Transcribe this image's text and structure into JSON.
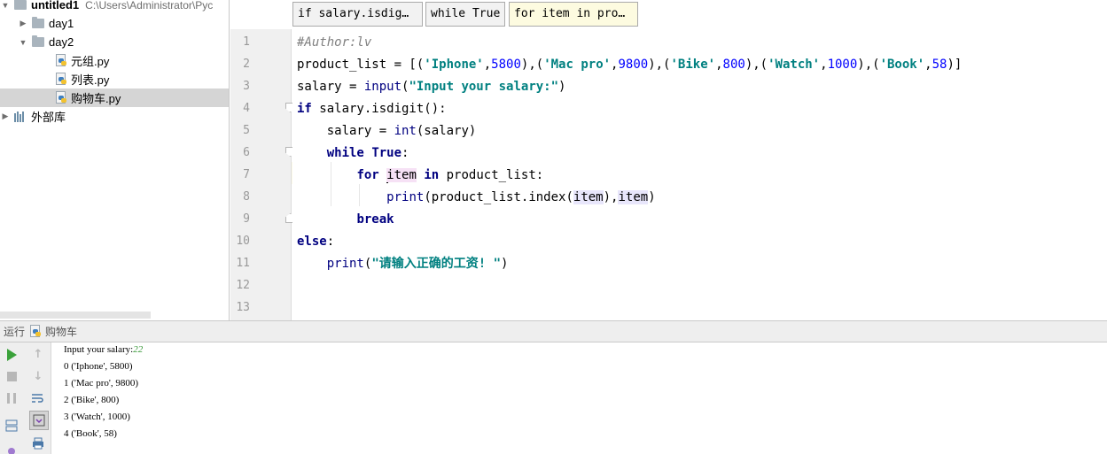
{
  "project": {
    "root_name": "untitled1",
    "root_path": "C:\\Users\\Administrator\\Pyc",
    "folders": [
      {
        "name": "day1",
        "expanded": false
      },
      {
        "name": "day2",
        "expanded": true
      }
    ],
    "files": [
      "元组.py",
      "列表.py",
      "购物车.py"
    ],
    "selected_file": "购物车.py",
    "external_libs": "外部库"
  },
  "editor": {
    "tabs": [
      "if salary.isdig…",
      "while True",
      "for item in pro…"
    ],
    "active_tab": 2,
    "line_numbers": [
      "1",
      "2",
      "3",
      "4",
      "5",
      "6",
      "7",
      "8",
      "9",
      "10",
      "11",
      "12",
      "13"
    ],
    "code": {
      "l1_comment": "#Author:lv",
      "l2_var": "product_list = [(",
      "l2_items": [
        {
          "name": "'Iphone'",
          "price": "5800"
        },
        {
          "name": "'Mac pro'",
          "price": "9800"
        },
        {
          "name": "'Bike'",
          "price": "800"
        },
        {
          "name": "'Watch'",
          "price": "1000"
        },
        {
          "name": "'Book'",
          "price": "58"
        }
      ],
      "l3_pre": "salary = ",
      "l3_fn": "input",
      "l3_str": "\"Input your salary:\"",
      "l4_kw": "if",
      "l4_rest": " salary.isdigit():",
      "l5_pre": "salary = ",
      "l5_fn": "int",
      "l5_rest": "(salary)",
      "l6_kw": "while",
      "l6_kw2": "True",
      "l6_rest": ":",
      "l7_kw": "for",
      "l7_var": "item",
      "l7_kw2": "in",
      "l7_rest": " product_list:",
      "l8_fn": "print",
      "l8_mid": "(product_list.index(",
      "l8_var": "item",
      "l8_sep": "),",
      "l8_var2": "item",
      "l8_end": ")",
      "l9_kw": "break",
      "l10_kw": "else",
      "l10_rest": ":",
      "l11_fn": "print",
      "l11_open": "(",
      "l11_str": "\"请输入正确的工资! \"",
      "l11_close": ")"
    }
  },
  "run": {
    "label": "运行",
    "config_name": "购物车",
    "output": {
      "prompt": "Input your salary:",
      "user_input": "22",
      "lines": [
        "0 ('Iphone', 5800)",
        "1 ('Mac pro', 9800)",
        "2 ('Bike', 800)",
        "3 ('Watch', 1000)",
        "4 ('Book', 58)"
      ]
    }
  },
  "colors": {
    "keyword": "#000080",
    "string": "#008080",
    "number": "#0000ff",
    "comment": "#808080",
    "run_green": "#3aa13a"
  }
}
